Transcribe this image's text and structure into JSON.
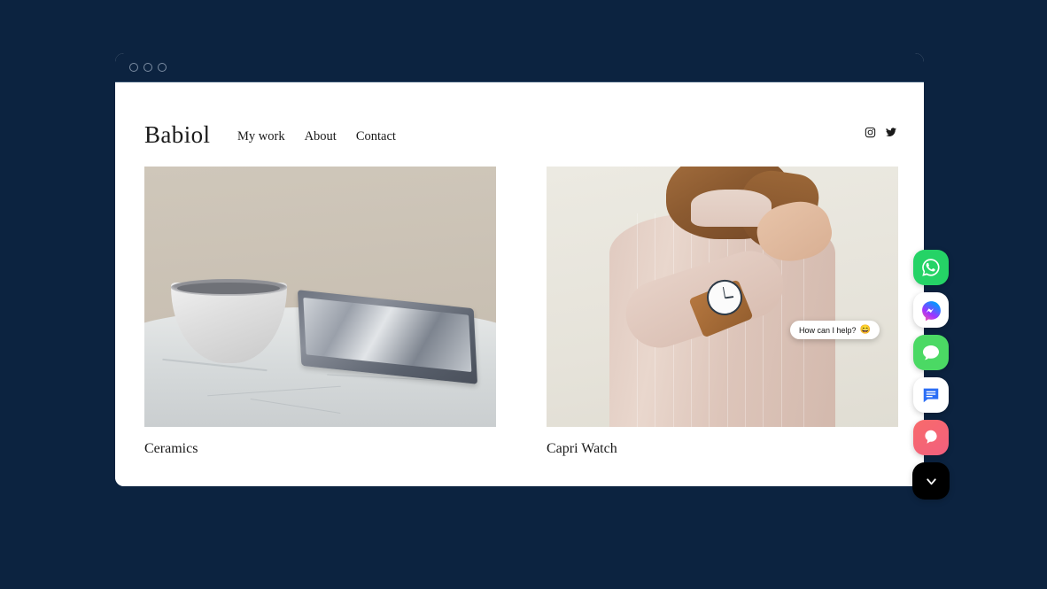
{
  "page": {
    "background_color": "#0c2340"
  },
  "browser": {
    "title_bar_color": "#0c2340",
    "traffic_lights": [
      "close",
      "minimize",
      "maximize"
    ]
  },
  "site": {
    "logo": "Babiol",
    "nav": [
      {
        "label": "My work"
      },
      {
        "label": "About"
      },
      {
        "label": "Contact"
      }
    ],
    "social": [
      {
        "name": "instagram-icon",
        "label": "Instagram"
      },
      {
        "name": "twitter-icon",
        "label": "Twitter"
      }
    ]
  },
  "gallery": {
    "items": [
      {
        "title": "Ceramics",
        "alt": "White ceramic bowl and marbled tray on a marble table"
      },
      {
        "title": "Capri Watch",
        "alt": "Woman in pink ribbed turtleneck wearing a minimalist watch with brown leather strap"
      }
    ]
  },
  "chat_widget": {
    "tooltip_text": "How can I help?",
    "tooltip_emoji": "😄",
    "buttons": [
      {
        "name": "whatsapp-button",
        "label": "WhatsApp",
        "color": "#25d366"
      },
      {
        "name": "messenger-button",
        "label": "Messenger",
        "color": "#ffffff"
      },
      {
        "name": "sms-button",
        "label": "SMS",
        "color": "#4bd964"
      },
      {
        "name": "chat-button",
        "label": "Live Chat",
        "color": "#ffffff"
      },
      {
        "name": "drift-button",
        "label": "Message",
        "color": "#f86b6b"
      },
      {
        "name": "collapse-button",
        "label": "Collapse",
        "color": "#000000"
      }
    ]
  }
}
